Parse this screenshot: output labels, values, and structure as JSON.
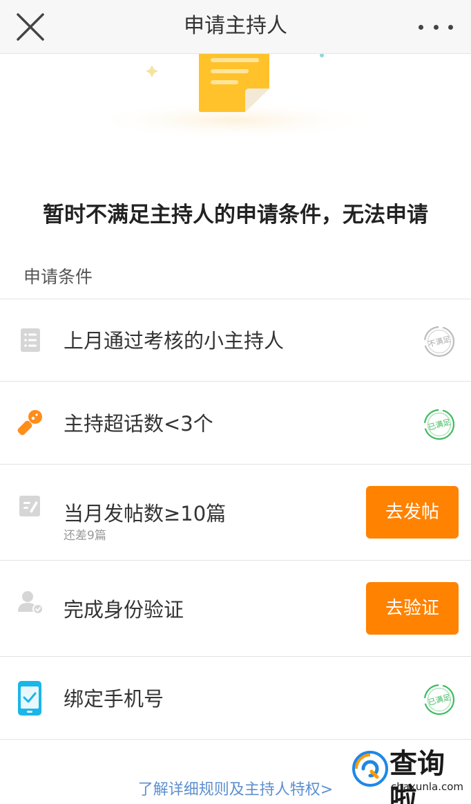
{
  "navbar": {
    "title": "申请主持人",
    "close_icon": "close-icon",
    "more_icon": "more-icon"
  },
  "status": {
    "message": "暂时不满足主持人的申请条件，无法申请"
  },
  "conditions": {
    "section_label": "申请条件",
    "items": [
      {
        "icon": "document-list-icon",
        "label": "上月通过考核的小主持人",
        "sub": "",
        "state": "unmet",
        "stamp_text": "不满足",
        "color": "#bbbbbb"
      },
      {
        "icon": "microphone-icon",
        "label": "主持超话数<3个",
        "sub": "",
        "state": "met",
        "stamp_text": "已满足",
        "color": "#3dbb5e"
      },
      {
        "icon": "edit-post-icon",
        "label": "当月发帖数≥10篇",
        "sub": "还差9篇",
        "state": "action",
        "action_label": "去发帖"
      },
      {
        "icon": "user-verify-icon",
        "label": "完成身份验证",
        "sub": "",
        "state": "action",
        "action_label": "去验证"
      },
      {
        "icon": "mobile-phone-icon",
        "label": "绑定手机号",
        "sub": "",
        "state": "met",
        "stamp_text": "已满足",
        "color": "#3dbb5e"
      }
    ]
  },
  "footer": {
    "rules_link": "了解详细规则及主持人特权>"
  },
  "watermark": {
    "title": "查询啦",
    "domain": "chaxunla.com"
  },
  "colors": {
    "accent": "#ff8200",
    "met": "#3dbb5e",
    "link": "#5c8fd0"
  }
}
